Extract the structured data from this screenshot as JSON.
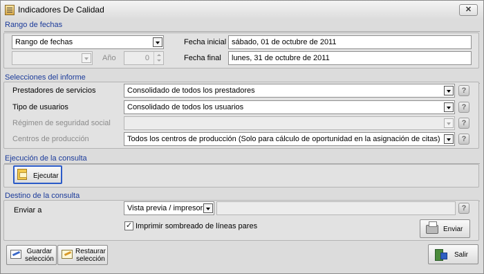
{
  "window": {
    "title": "Indicadores De Calidad",
    "close_glyph": "✕"
  },
  "rango": {
    "section_title": "Rango de fechas",
    "range_type_value": "Rango de fechas",
    "month_value": "",
    "year_label": "Año",
    "year_value": "0",
    "fecha_inicial_label": "Fecha inicial",
    "fecha_inicial_value": "sábado, 01 de octubre de 2011",
    "fecha_final_label": "Fecha final",
    "fecha_final_value": "lunes, 31 de octubre de 2011"
  },
  "selecciones": {
    "section_title": "Selecciones del informe",
    "prestadores_label": "Prestadores de servicios",
    "prestadores_value": "Consolidado de todos los prestadores",
    "tipo_usuarios_label": "Tipo de usuarios",
    "tipo_usuarios_value": "Consolidado de todos los usuarios",
    "regimen_label": "Régimen de seguridad social",
    "regimen_value": "",
    "centros_label": "Centros de producción",
    "centros_value": "Todos los centros de producción (Solo para cálculo de oportunidad en la asignación de citas)",
    "help_glyph": "?"
  },
  "ejecucion": {
    "section_title": "Ejecución de la consulta",
    "run_label": "Ejecutar"
  },
  "destino": {
    "section_title": "Destino de la consulta",
    "enviar_a_label": "Enviar a",
    "enviar_a_value": "Vista previa / impresora",
    "destination_path_value": "",
    "shade_label": "Imprimir sombreado de líneas pares",
    "shade_checked": true,
    "check_glyph": "✓",
    "send_label": "Enviar"
  },
  "footer": {
    "save_selection_label": "Guardar\nselección",
    "restore_selection_label": "Restaurar\nselección",
    "exit_label": "Salir"
  },
  "colors": {
    "section_title": "#1a3a9a",
    "window_bg": "#dcdcdc",
    "panel_bg": "#e2e2e2"
  }
}
